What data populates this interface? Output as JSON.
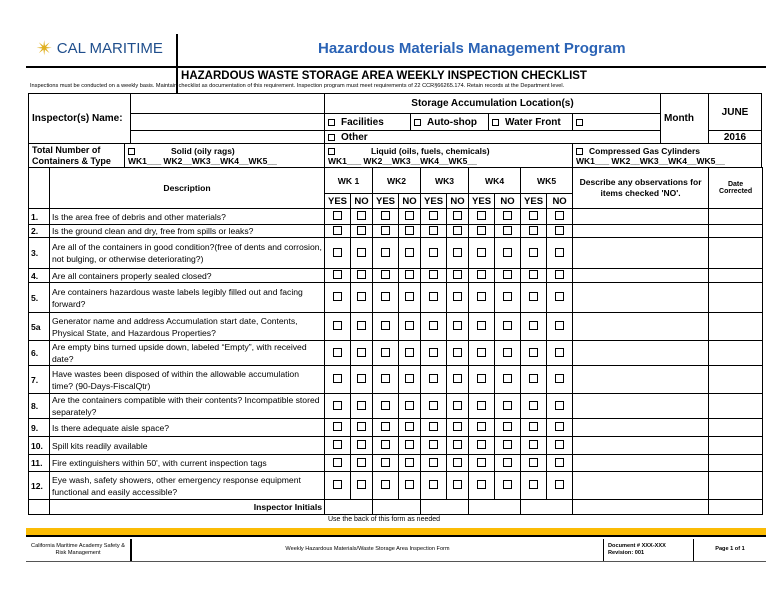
{
  "header": {
    "logo_text": "CAL MARITIME",
    "program": "Hazardous Materials Management Program"
  },
  "title": "HAZARDOUS WASTE STORAGE AREA WEEKLY INSPECTION CHECKLIST",
  "note": "Inspections must be conducted on a weekly basis.  Maintain checklist as documentation of this requirement. Inspection program must meet requirements of 22 CCR§66265.174. Retain records at the Department level.",
  "top": {
    "inspector_label": "Inspector(s) Name:",
    "inspector_value": "",
    "storage_label": "Storage  Accumulation Location(s)",
    "locations": [
      "Facilities",
      "Auto-shop",
      "Water Front",
      ""
    ],
    "other": "Other",
    "month_label": "Month",
    "month": "JUNE",
    "year": "2016",
    "total_label": "Total Number of Containers & Type",
    "types": [
      {
        "name": "Solid (oily rags)",
        "weeks": "WK1___ WK2__WK3__WK4__WK5__"
      },
      {
        "name": "Liquid (oils, fuels, chemicals)",
        "weeks": "WK1___ WK2__WK3__WK4__WK5__"
      },
      {
        "name": "Compressed Gas Cylinders",
        "weeks": "WK1___ WK2__WK3__WK4__WK5__"
      }
    ]
  },
  "table": {
    "description": "Description",
    "weeks": [
      "WK 1",
      "WK2",
      "WK3",
      "WK4",
      "WK5"
    ],
    "yes": "YES",
    "no": "NO",
    "observations": "Describe any observations for items checked 'NO'.",
    "date": "Date Corrected",
    "items": [
      {
        "num": "1.",
        "text": "Is the area free of debris and other materials?"
      },
      {
        "num": "2.",
        "text": "Is the ground clean and dry, free from spills or leaks?"
      },
      {
        "num": "3.",
        "text": "Are all of the containers in good condition?(free of dents and corrosion, not bulging, or otherwise deteriorating?)"
      },
      {
        "num": "4.",
        "text": "Are all containers properly sealed closed?"
      },
      {
        "num": "5.",
        "text": "Are containers hazardous waste labels legibly filled out and facing forward?"
      },
      {
        "num": "5a",
        "text": "Generator name and address Accumulation start date, Contents, Physical State, and Hazardous Properties?"
      },
      {
        "num": "6.",
        "text": "Are empty bins turned upside down, labeled “Empty”, with received date?"
      },
      {
        "num": "7.",
        "text": "Have wastes been disposed of within the allowable accumulation time? (90-Days-FiscalQtr)"
      },
      {
        "num": "8.",
        "text": "Are the containers compatible with their contents? Incompatible stored separately?"
      },
      {
        "num": "9.",
        "text": "Is there adequate aisle space?"
      },
      {
        "num": "10.",
        "text": "Spill kits readily available"
      },
      {
        "num": "11.",
        "text": "Fire extinguishers within 50', with current inspection tags"
      },
      {
        "num": "12.",
        "text": "Eye wash, safety showers, other emergency response equipment functional and easily accessible?"
      }
    ],
    "initials": "Inspector Initials"
  },
  "back_note": "Use the back of this form as needed",
  "footer": {
    "org": "California Maritime Academy Safety & Risk Management",
    "form": "Weekly Hazardous Materials/Waste Storage Area Inspection Form",
    "doc": "Document # XXX-XXX",
    "rev": "Revision: 001",
    "page": "Page 1 of 1"
  }
}
